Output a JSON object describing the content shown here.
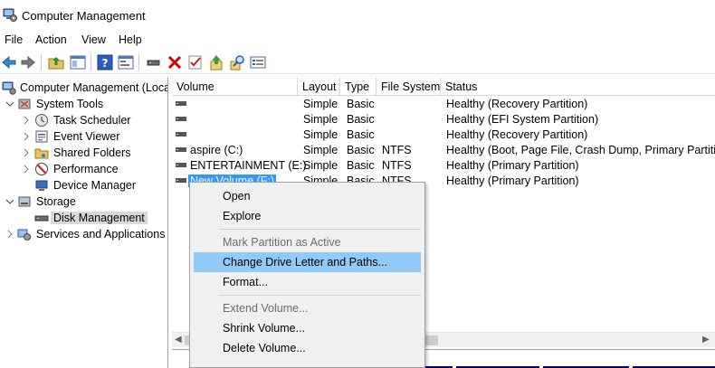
{
  "window": {
    "title": "Computer Management"
  },
  "menu": [
    "File",
    "Action",
    "View",
    "Help"
  ],
  "toolbar": {
    "icons": [
      "back-arrow-icon",
      "forward-arrow-icon",
      "up-folder-icon",
      "show-hide-tree-icon",
      "help-icon",
      "properties-icon",
      "connect-icon",
      "delete-icon",
      "check-icon",
      "export-icon",
      "search-icon",
      "view-list-icon"
    ],
    "colors": {
      "delete": "#d40000",
      "accent": "#2a5cb8"
    }
  },
  "tree": {
    "root": "Computer Management (Local",
    "system_tools": "System Tools",
    "task_scheduler": "Task Scheduler",
    "event_viewer": "Event Viewer",
    "shared_folders": "Shared Folders",
    "performance": "Performance",
    "device_manager": "Device Manager",
    "storage": "Storage",
    "disk_management": "Disk Management",
    "services": "Services and Applications"
  },
  "columns": {
    "volume": "Volume",
    "layout": "Layout",
    "type": "Type",
    "fs": "File System",
    "status": "Status"
  },
  "rows": [
    {
      "volume": "",
      "layout": "Simple",
      "type": "Basic",
      "fs": "",
      "status": "Healthy (Recovery Partition)"
    },
    {
      "volume": "",
      "layout": "Simple",
      "type": "Basic",
      "fs": "",
      "status": "Healthy (EFI System Partition)"
    },
    {
      "volume": "",
      "layout": "Simple",
      "type": "Basic",
      "fs": "",
      "status": "Healthy (Recovery Partition)"
    },
    {
      "volume": "aspire (C:)",
      "layout": "Simple",
      "type": "Basic",
      "fs": "NTFS",
      "status": "Healthy (Boot, Page File, Crash Dump, Primary Partition"
    },
    {
      "volume": "ENTERTAINMENT (E:)",
      "layout": "Simple",
      "type": "Basic",
      "fs": "NTFS",
      "status": "Healthy (Primary Partition)"
    },
    {
      "volume": "New Volume (F:)",
      "layout": "Simple",
      "type": "Basic",
      "fs": "NTFS",
      "status": "Healthy (Primary Partition)"
    }
  ],
  "context_menu": {
    "open": "Open",
    "explore": "Explore",
    "mark_active": "Mark Partition as Active",
    "change_letter": "Change Drive Letter and Paths...",
    "format": "Format...",
    "extend": "Extend Volume...",
    "shrink": "Shrink Volume...",
    "delete": "Delete Volume..."
  },
  "colors": {
    "selection": "#3399ff",
    "menu_highlight": "#91c9f7",
    "menu_background": "#f0f0f0",
    "disk_bar": "#000080"
  }
}
